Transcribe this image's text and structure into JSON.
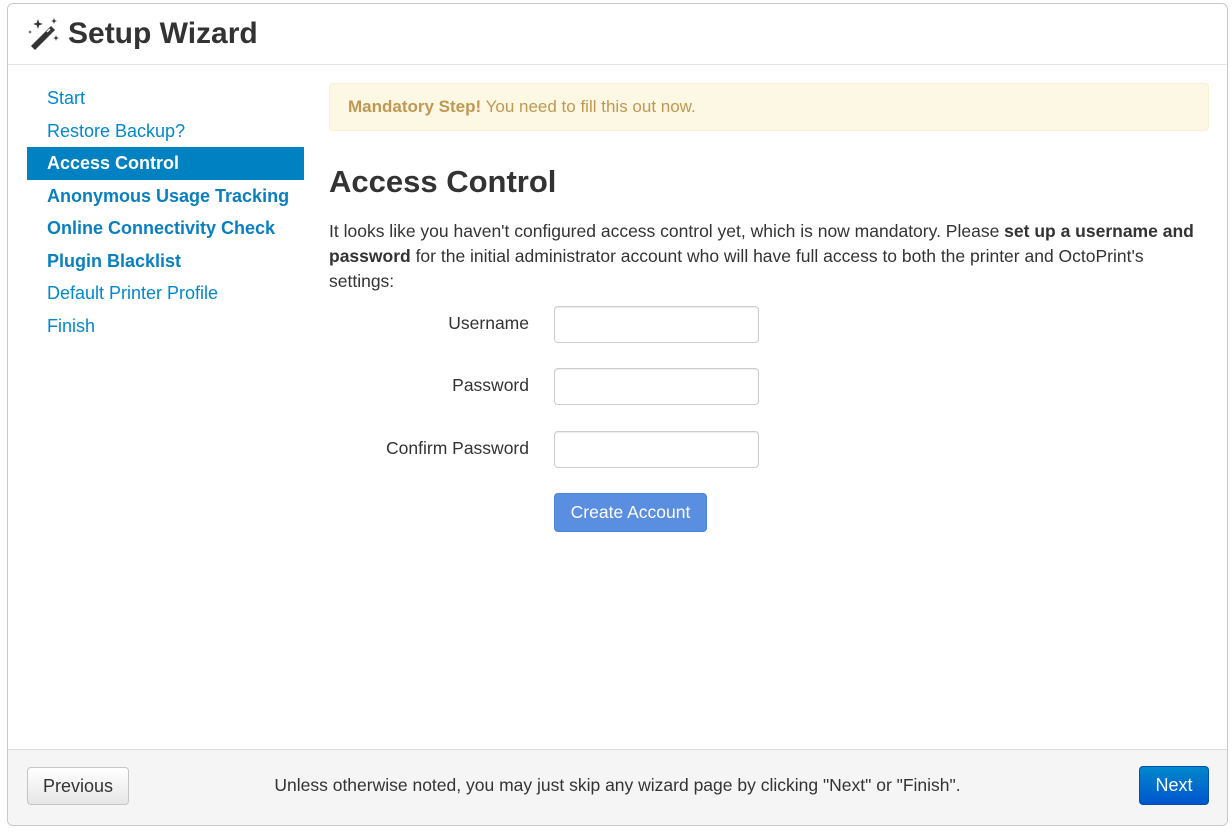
{
  "header": {
    "title": "Setup Wizard",
    "icon": "magic-wand-icon"
  },
  "sidebar": {
    "items": [
      {
        "label": "Start"
      },
      {
        "label": "Restore Backup?"
      },
      {
        "label": "Access Control"
      },
      {
        "label": "Anonymous Usage Tracking"
      },
      {
        "label": "Online Connectivity Check"
      },
      {
        "label": "Plugin Blacklist"
      },
      {
        "label": "Default Printer Profile"
      },
      {
        "label": "Finish"
      }
    ]
  },
  "alert": {
    "strong": "Mandatory Step!",
    "text": " You need to fill this out now."
  },
  "main": {
    "title": "Access Control",
    "intro_1": "It looks like you haven't configured access control yet, which is now mandatory. Please ",
    "intro_bold": "set up a username and password",
    "intro_2": " for the initial administrator account who will have full access to both the printer and OctoPrint's settings:",
    "username_label": "Username",
    "username_value": "",
    "password_label": "Password",
    "password_value": "",
    "confirm_label": "Confirm Password",
    "confirm_value": "",
    "create_label": "Create Account"
  },
  "footer": {
    "previous_label": "Previous",
    "note": "Unless otherwise noted, you may just skip any wizard page by clicking \"Next\" or \"Finish\".",
    "next_label": "Next"
  },
  "colors": {
    "link": "#0088cc",
    "active_bg": "#0081c2",
    "alert_bg": "#fcf8e3",
    "alert_text": "#c09853",
    "create_button": "#5a8ee0",
    "next_button": "#0066cc"
  }
}
